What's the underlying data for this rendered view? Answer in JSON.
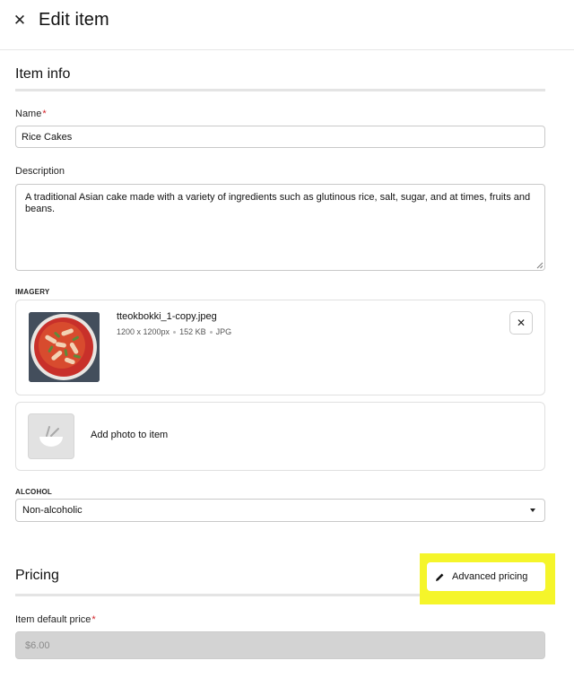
{
  "header": {
    "close_icon": "close-icon",
    "title": "Edit item"
  },
  "item_info": {
    "title": "Item info",
    "name_label": "Name",
    "required_marker": "*",
    "name_value": "Rice Cakes",
    "description_label": "Description",
    "description_value": "A traditional Asian cake made with a variety of ingredients such as glutinous rice, salt, sugar, and at times, fruits and beans."
  },
  "imagery": {
    "label": "IMAGERY",
    "file_name": "tteokbokki_1-copy.jpeg",
    "dimensions": "1200 x 1200px",
    "size": "152 KB",
    "format": "JPG",
    "remove_icon": "close-icon",
    "add_label": "Add photo to item",
    "add_icon": "bowl-icon"
  },
  "alcohol": {
    "label": "ALCOHOL",
    "selected": "Non-alcoholic"
  },
  "pricing": {
    "title": "Pricing",
    "advanced_label": "Advanced pricing",
    "advanced_icon": "pencil-icon",
    "default_price_label": "Item default price",
    "default_price_value": "$6.00"
  },
  "colors": {
    "highlight": "#f5f52a",
    "required": "#d2232a",
    "disabled_field": "#d3d3d3"
  }
}
